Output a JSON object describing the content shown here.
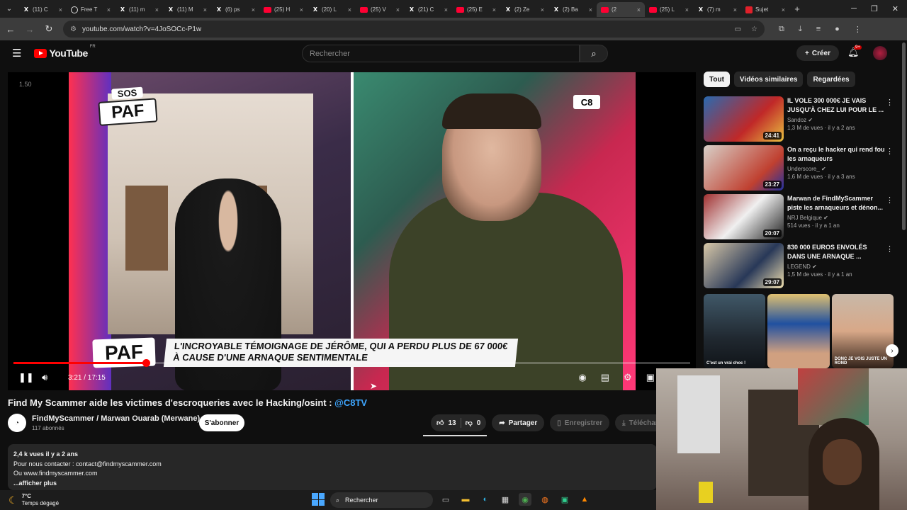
{
  "tabs": [
    {
      "favicon": "x",
      "label": "(11) C"
    },
    {
      "favicon": "circle",
      "label": "Free T"
    },
    {
      "favicon": "x",
      "label": "(11) m"
    },
    {
      "favicon": "x",
      "label": "(11) M"
    },
    {
      "favicon": "x",
      "label": "(6) ps"
    },
    {
      "favicon": "yt",
      "label": "(25) H"
    },
    {
      "favicon": "x",
      "label": "(20) L"
    },
    {
      "favicon": "yt",
      "label": "(25) V"
    },
    {
      "favicon": "x",
      "label": "(21) C"
    },
    {
      "favicon": "yt",
      "label": "(25) E"
    },
    {
      "favicon": "x",
      "label": "(2) Ze"
    },
    {
      "favicon": "x",
      "label": "(2) Ba"
    },
    {
      "favicon": "yt",
      "label": "(2"
    },
    {
      "favicon": "yt",
      "label": "(25) L"
    },
    {
      "favicon": "x",
      "label": "(7) m"
    },
    {
      "favicon": "red",
      "label": "Sujet"
    }
  ],
  "browser": {
    "url": "youtube.com/watch?v=4JoSOCc-P1w"
  },
  "youtube": {
    "logo_text": "YouTube",
    "region": "FR",
    "search_placeholder": "Rechercher",
    "create_label": "Créer",
    "notif_count": "9+"
  },
  "player": {
    "speed_overlay": "1.50",
    "c8_logo": "C8",
    "sos_label": "SOS",
    "paf_label": "PAF",
    "paf_bottom": "PAF",
    "banner_text": "L'INCROYABLE TÉMOIGNAGE DE JÉRÔME, QUI A PERDU PLUS DE 67 000€ À CAUSE D'UNE ARNAQUE SENTIMENTALE",
    "time_display": "3:21 / 17:15",
    "progress_fraction": 0.196
  },
  "video": {
    "title": "Find My Scammer aide les victimes d'escroqueries avec le Hacking/osint : ",
    "title_tag": "@C8TV",
    "channel_name": "FindMyScammer / Marwan Ouarab (Merwane)",
    "subscribers": "117 abonnés",
    "subscribe_label": "S'abonner",
    "likes": "13",
    "dislikes": "0",
    "share_label": "Partager",
    "save_label": "Enregistrer",
    "download_label": "Télécharger"
  },
  "description": {
    "meta": "2,4 k vues  il y a 2 ans",
    "line1": "Pour nous contacter : contact@findmyscammer.com",
    "line2": "Ou www.findmyscammer.com",
    "more": "...afficher plus"
  },
  "chips": [
    "Tout",
    "Vidéos similaires",
    "Regardées"
  ],
  "recommendations": [
    {
      "title": "IL VOLE 300 000€ JE VAIS JUSQU'À CHEZ LUI POUR LE ...",
      "channel": "Sandoz",
      "meta": "1,3 M de vues · il y a 2 ans",
      "duration": "24:41"
    },
    {
      "title": "On a reçu le hacker qui rend fou les arnaqueurs",
      "channel": "Underscore_",
      "meta": "1,6 M de vues · il y a 3 ans",
      "duration": "23:27"
    },
    {
      "title": "Marwan de FindMyScammer piste les arnaqueurs et dénon...",
      "channel": "NRJ Belgique",
      "meta": "514 vues · il y a 1 an",
      "duration": "20:07"
    },
    {
      "title": "830 000 EUROS ENVOLÉS DANS UNE ARNAQUE ...",
      "channel": "LEGEND",
      "meta": "1,5 M de vues · il y a 1 an",
      "duration": "29:07"
    }
  ],
  "shorts": [
    {
      "caption": "C'est un vrai choc !"
    },
    {
      "caption": ""
    },
    {
      "caption": "DONC JE VOIS JUSTE UN ROND"
    }
  ],
  "taskbar": {
    "temperature": "7°C",
    "weather": "Temps dégagé",
    "search_label": "Rechercher"
  },
  "colors": {
    "yt_red": "#ff0000",
    "link_blue": "#3ea6ff",
    "bg": "#0f0f0f"
  }
}
